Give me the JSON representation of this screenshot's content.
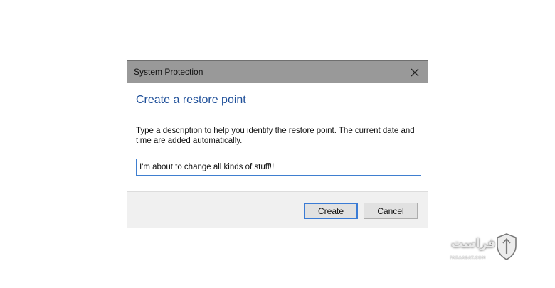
{
  "dialog": {
    "title": "System Protection",
    "heading": "Create a restore point",
    "description": "Type a description to help you identify the restore point. The current date and time are added automatically.",
    "input_value": "I'm about to change all kinds of stuff!!",
    "create_accel": "C",
    "create_rest": "reate",
    "cancel_label": "Cancel"
  },
  "watermark": {
    "text": "فراست",
    "sub": "FARAASAT.COM"
  },
  "colors": {
    "titlebar": "#999999",
    "heading": "#1e4f99",
    "focus_border": "#3a7bd5"
  },
  "icons": {
    "close": "close-icon",
    "logo": "shield-logo-icon"
  }
}
